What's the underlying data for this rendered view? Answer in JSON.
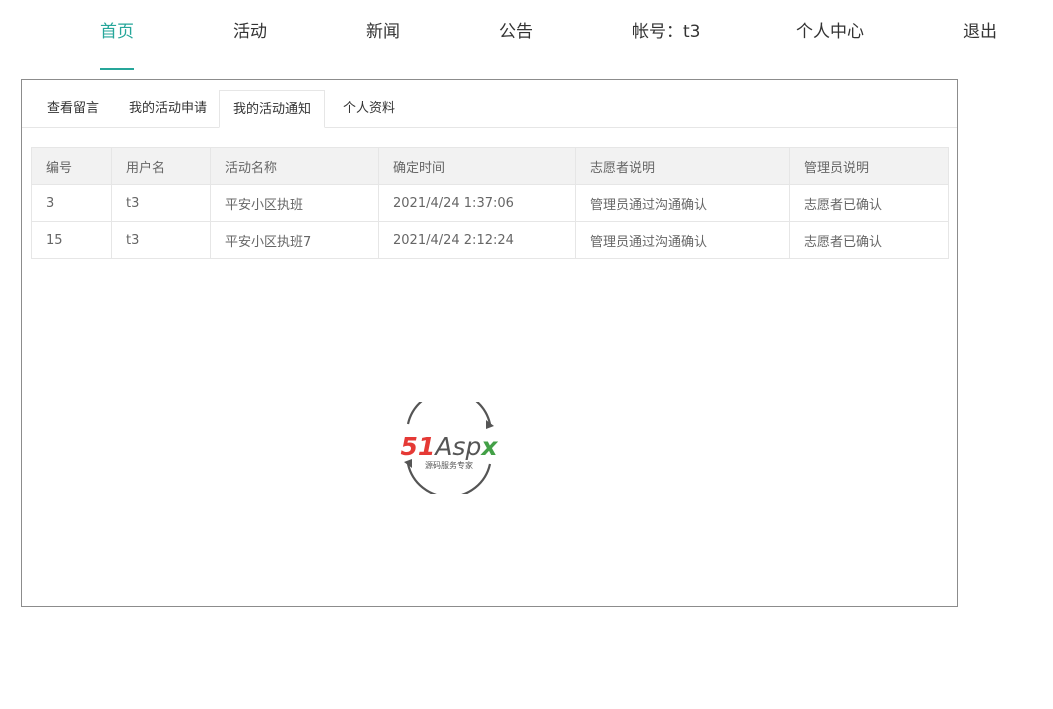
{
  "nav": {
    "items": [
      {
        "label": "首页",
        "active": true
      },
      {
        "label": "活动",
        "active": false
      },
      {
        "label": "新闻",
        "active": false
      },
      {
        "label": "公告",
        "active": false
      },
      {
        "label": "帐号：t3",
        "active": false
      },
      {
        "label": "个人中心",
        "active": false
      },
      {
        "label": "退出",
        "active": false
      }
    ],
    "accent_color": "#26a69a"
  },
  "tabs": [
    {
      "label": "查看留言",
      "active": false
    },
    {
      "label": "我的活动申请",
      "active": false
    },
    {
      "label": "我的活动通知",
      "active": true
    },
    {
      "label": "个人资料",
      "active": false
    }
  ],
  "table": {
    "headers": [
      "编号",
      "用户名",
      "活动名称",
      "确定时间",
      "志愿者说明",
      "管理员说明"
    ],
    "rows": [
      [
        "3",
        "t3",
        "平安小区执班",
        "2021/4/24 1:37:06",
        "管理员通过沟通确认",
        "志愿者已确认"
      ],
      [
        "15",
        "t3",
        "平安小区执班7",
        "2021/4/24 2:12:24",
        "管理员通过沟通确认",
        "志愿者已确认"
      ]
    ]
  },
  "watermark": {
    "brand": "51Aspx",
    "tagline": "源码服务专家",
    "colors": {
      "five_one": "#e53935",
      "aspx": "#555555",
      "x": "#43a047"
    }
  }
}
